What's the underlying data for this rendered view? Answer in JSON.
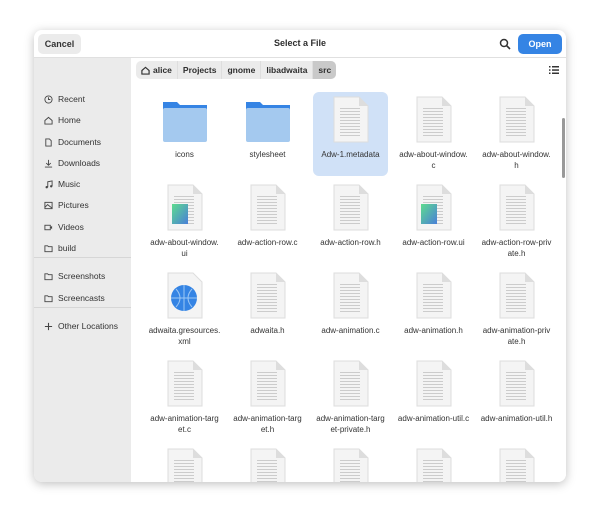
{
  "header": {
    "cancel": "Cancel",
    "title": "Select a File",
    "open": "Open"
  },
  "sidebar": {
    "items": [
      {
        "label": "Recent",
        "icon": "clock-icon"
      },
      {
        "label": "Home",
        "icon": "home-icon"
      },
      {
        "label": "Documents",
        "icon": "document-icon"
      },
      {
        "label": "Downloads",
        "icon": "download-icon"
      },
      {
        "label": "Music",
        "icon": "music-icon"
      },
      {
        "label": "Pictures",
        "icon": "picture-icon"
      },
      {
        "label": "Videos",
        "icon": "video-icon"
      },
      {
        "label": "build",
        "icon": "folder-icon"
      },
      {
        "label": "Screenshots",
        "icon": "folder-icon"
      },
      {
        "label": "Screencasts",
        "icon": "folder-icon"
      },
      {
        "label": "Other Locations",
        "icon": "plus-icon"
      }
    ]
  },
  "breadcrumb": [
    "alice",
    "Projects",
    "gnome",
    "libadwaita",
    "src"
  ],
  "files": [
    {
      "name": "icons",
      "type": "folder"
    },
    {
      "name": "stylesheet",
      "type": "folder"
    },
    {
      "name": "Adw-1.metadata",
      "type": "text",
      "selected": true
    },
    {
      "name": "adw-about-window.c",
      "type": "text"
    },
    {
      "name": "adw-about-window.h",
      "type": "text"
    },
    {
      "name": "adw-about-window.ui",
      "type": "ui"
    },
    {
      "name": "adw-action-row.c",
      "type": "text"
    },
    {
      "name": "adw-action-row.h",
      "type": "text"
    },
    {
      "name": "adw-action-row.ui",
      "type": "ui"
    },
    {
      "name": "adw-action-row-private.h",
      "type": "text"
    },
    {
      "name": "adwaita.gresources.xml",
      "type": "xml"
    },
    {
      "name": "adwaita.h",
      "type": "text"
    },
    {
      "name": "adw-animation.c",
      "type": "text"
    },
    {
      "name": "adw-animation.h",
      "type": "text"
    },
    {
      "name": "adw-animation-private.h",
      "type": "text"
    },
    {
      "name": "adw-animation-target.c",
      "type": "text"
    },
    {
      "name": "adw-animation-target.h",
      "type": "text"
    },
    {
      "name": "adw-animation-target-private.h",
      "type": "text"
    },
    {
      "name": "adw-animation-util.c",
      "type": "text"
    },
    {
      "name": "adw-animation-util.h",
      "type": "text"
    },
    {
      "name": "",
      "type": "text"
    },
    {
      "name": "",
      "type": "text"
    },
    {
      "name": "",
      "type": "text"
    },
    {
      "name": "",
      "type": "text"
    },
    {
      "name": "",
      "type": "text"
    }
  ]
}
